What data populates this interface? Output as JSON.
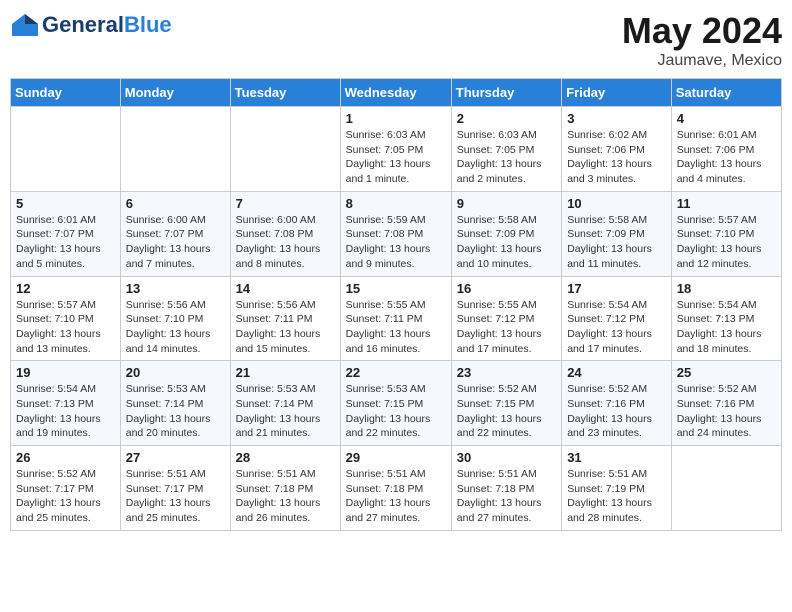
{
  "header": {
    "logo_general": "General",
    "logo_blue": "Blue",
    "month_year": "May 2024",
    "location": "Jaumave, Mexico"
  },
  "weekdays": [
    "Sunday",
    "Monday",
    "Tuesday",
    "Wednesday",
    "Thursday",
    "Friday",
    "Saturday"
  ],
  "weeks": [
    [
      {
        "day": "",
        "info": ""
      },
      {
        "day": "",
        "info": ""
      },
      {
        "day": "",
        "info": ""
      },
      {
        "day": "1",
        "info": "Sunrise: 6:03 AM\nSunset: 7:05 PM\nDaylight: 13 hours and 1 minute."
      },
      {
        "day": "2",
        "info": "Sunrise: 6:03 AM\nSunset: 7:05 PM\nDaylight: 13 hours and 2 minutes."
      },
      {
        "day": "3",
        "info": "Sunrise: 6:02 AM\nSunset: 7:06 PM\nDaylight: 13 hours and 3 minutes."
      },
      {
        "day": "4",
        "info": "Sunrise: 6:01 AM\nSunset: 7:06 PM\nDaylight: 13 hours and 4 minutes."
      }
    ],
    [
      {
        "day": "5",
        "info": "Sunrise: 6:01 AM\nSunset: 7:07 PM\nDaylight: 13 hours and 5 minutes."
      },
      {
        "day": "6",
        "info": "Sunrise: 6:00 AM\nSunset: 7:07 PM\nDaylight: 13 hours and 7 minutes."
      },
      {
        "day": "7",
        "info": "Sunrise: 6:00 AM\nSunset: 7:08 PM\nDaylight: 13 hours and 8 minutes."
      },
      {
        "day": "8",
        "info": "Sunrise: 5:59 AM\nSunset: 7:08 PM\nDaylight: 13 hours and 9 minutes."
      },
      {
        "day": "9",
        "info": "Sunrise: 5:58 AM\nSunset: 7:09 PM\nDaylight: 13 hours and 10 minutes."
      },
      {
        "day": "10",
        "info": "Sunrise: 5:58 AM\nSunset: 7:09 PM\nDaylight: 13 hours and 11 minutes."
      },
      {
        "day": "11",
        "info": "Sunrise: 5:57 AM\nSunset: 7:10 PM\nDaylight: 13 hours and 12 minutes."
      }
    ],
    [
      {
        "day": "12",
        "info": "Sunrise: 5:57 AM\nSunset: 7:10 PM\nDaylight: 13 hours and 13 minutes."
      },
      {
        "day": "13",
        "info": "Sunrise: 5:56 AM\nSunset: 7:10 PM\nDaylight: 13 hours and 14 minutes."
      },
      {
        "day": "14",
        "info": "Sunrise: 5:56 AM\nSunset: 7:11 PM\nDaylight: 13 hours and 15 minutes."
      },
      {
        "day": "15",
        "info": "Sunrise: 5:55 AM\nSunset: 7:11 PM\nDaylight: 13 hours and 16 minutes."
      },
      {
        "day": "16",
        "info": "Sunrise: 5:55 AM\nSunset: 7:12 PM\nDaylight: 13 hours and 17 minutes."
      },
      {
        "day": "17",
        "info": "Sunrise: 5:54 AM\nSunset: 7:12 PM\nDaylight: 13 hours and 17 minutes."
      },
      {
        "day": "18",
        "info": "Sunrise: 5:54 AM\nSunset: 7:13 PM\nDaylight: 13 hours and 18 minutes."
      }
    ],
    [
      {
        "day": "19",
        "info": "Sunrise: 5:54 AM\nSunset: 7:13 PM\nDaylight: 13 hours and 19 minutes."
      },
      {
        "day": "20",
        "info": "Sunrise: 5:53 AM\nSunset: 7:14 PM\nDaylight: 13 hours and 20 minutes."
      },
      {
        "day": "21",
        "info": "Sunrise: 5:53 AM\nSunset: 7:14 PM\nDaylight: 13 hours and 21 minutes."
      },
      {
        "day": "22",
        "info": "Sunrise: 5:53 AM\nSunset: 7:15 PM\nDaylight: 13 hours and 22 minutes."
      },
      {
        "day": "23",
        "info": "Sunrise: 5:52 AM\nSunset: 7:15 PM\nDaylight: 13 hours and 22 minutes."
      },
      {
        "day": "24",
        "info": "Sunrise: 5:52 AM\nSunset: 7:16 PM\nDaylight: 13 hours and 23 minutes."
      },
      {
        "day": "25",
        "info": "Sunrise: 5:52 AM\nSunset: 7:16 PM\nDaylight: 13 hours and 24 minutes."
      }
    ],
    [
      {
        "day": "26",
        "info": "Sunrise: 5:52 AM\nSunset: 7:17 PM\nDaylight: 13 hours and 25 minutes."
      },
      {
        "day": "27",
        "info": "Sunrise: 5:51 AM\nSunset: 7:17 PM\nDaylight: 13 hours and 25 minutes."
      },
      {
        "day": "28",
        "info": "Sunrise: 5:51 AM\nSunset: 7:18 PM\nDaylight: 13 hours and 26 minutes."
      },
      {
        "day": "29",
        "info": "Sunrise: 5:51 AM\nSunset: 7:18 PM\nDaylight: 13 hours and 27 minutes."
      },
      {
        "day": "30",
        "info": "Sunrise: 5:51 AM\nSunset: 7:18 PM\nDaylight: 13 hours and 27 minutes."
      },
      {
        "day": "31",
        "info": "Sunrise: 5:51 AM\nSunset: 7:19 PM\nDaylight: 13 hours and 28 minutes."
      },
      {
        "day": "",
        "info": ""
      }
    ]
  ]
}
